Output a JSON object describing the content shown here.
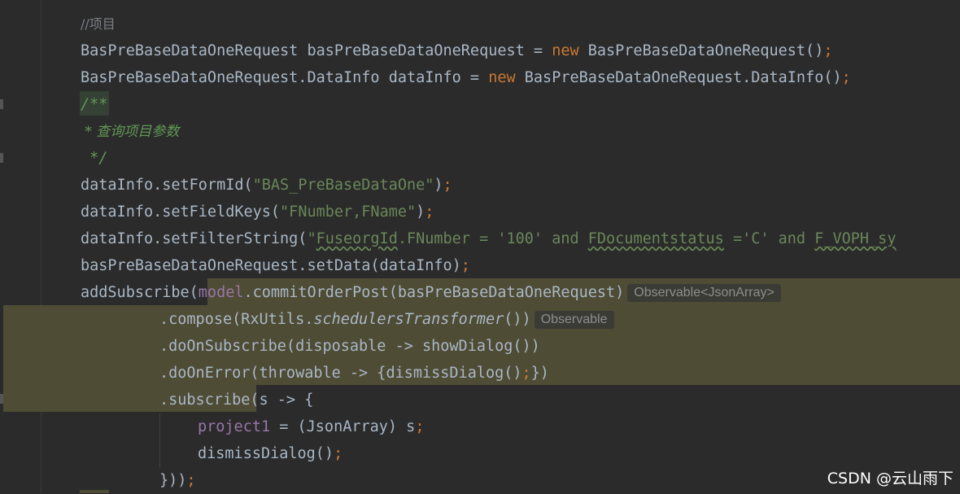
{
  "code": {
    "l1_comment": "//项目",
    "l2": {
      "type": "BasPreBaseDataOneRequest",
      "var": " basPreBaseDataOneRequest = ",
      "new_kw": "new",
      "ctor": " BasPreBaseDataOneRequest()",
      "semi": ";"
    },
    "l3": {
      "type": "BasPreBaseDataOneRequest.DataInfo dataInfo = ",
      "new_kw": "new",
      "ctor": " BasPreBaseDataOneRequest.DataInfo()",
      "semi": ";"
    },
    "l4_doc_open": "/**",
    "l5_doc_text": " * 查询项目参数",
    "l6_doc_close": " */",
    "l7": {
      "pre": "dataInfo.setFormId(",
      "str": "\"BAS_PreBaseDataOne\"",
      "post": ")",
      "semi": ";"
    },
    "l8": {
      "pre": "dataInfo.setFieldKeys(",
      "str": "\"FNumber,FName\"",
      "post": ")",
      "semi": ";"
    },
    "l9": {
      "pre": "dataInfo.setFilterString(",
      "q": "\"",
      "s1": "FuseorgId",
      "s2": ".FNumber = '100' and ",
      "s3": "FDocumentstatus",
      "s4": " ='C' and ",
      "s5": "F_VOPH_sy"
    },
    "l10": {
      "pre": "basPreBaseDataOneRequest.setData(dataInfo)",
      "semi": ";"
    },
    "l11": {
      "pre": "addSubscribe(",
      "field": "model",
      "post": ".commitOrderPost(basPreBaseDataOneRequest)",
      "hint": "Observable<JsonArray>"
    },
    "l12": {
      "pre": ".compose(RxUtils.",
      "method": "schedulersTransformer",
      "post": "())",
      "hint": "Observable"
    },
    "l13": ".doOnSubscribe(disposable -> showDialog())",
    "l14": {
      "pre": ".doOnError(throwable -> {dismissDialog()",
      "semi": ";",
      "post": "})"
    },
    "l15": ".subscribe(s -> {",
    "l16": {
      "field": "project1",
      "post": " = (JsonArray) s",
      "semi": ";"
    },
    "l17": {
      "pre": "dismissDialog()",
      "semi": ";"
    },
    "l18": {
      "pre": "}))",
      "semi": ";"
    }
  },
  "watermark": "CSDN @云山雨下",
  "colors": {
    "background": "#2b2b2b",
    "keyword": "#cc7832",
    "string": "#6a8759",
    "field": "#9876aa",
    "doc_comment": "#629755",
    "highlight": "#4f4c35"
  }
}
